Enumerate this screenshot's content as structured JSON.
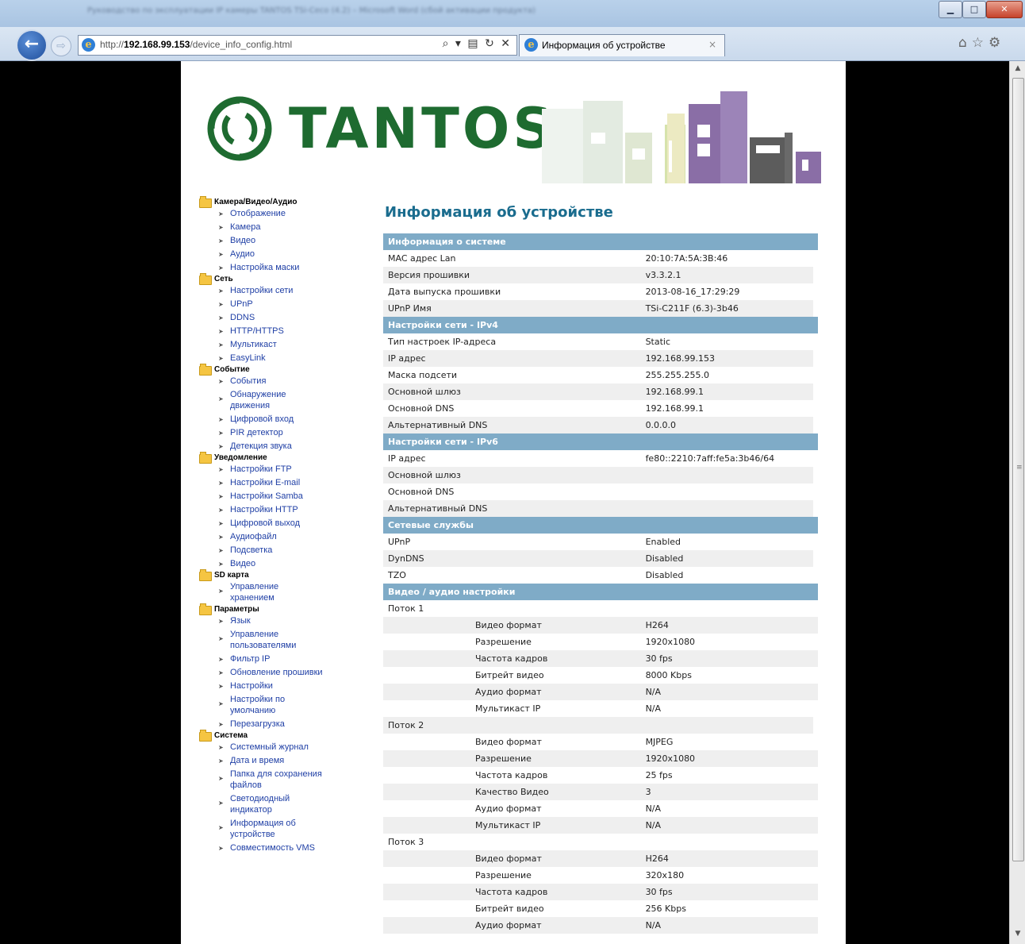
{
  "browser": {
    "url_prefix": "http://",
    "url_host": "192.168.99.153",
    "url_path": "/device_info_config.html",
    "address_icons": "⌕ ▾ ▤ ↻ ✕",
    "tab_title": "Информация об устройстве",
    "tab_close": "×",
    "title_blurred": "Руководство по эксплуатации IP камеры TANTOS TSi-Ceco (4.2) – Microsoft Word (сбой активации продукта)",
    "window_controls": {
      "minimize": "▁",
      "maximize": "□",
      "close": "✕"
    },
    "tools_icons": [
      "home-icon",
      "star-icon",
      "gear-icon"
    ]
  },
  "logo": {
    "text": "TANTOS",
    "brand_color": "#1e6b30"
  },
  "sidebar": [
    {
      "label": "Камера/Видео/Аудио",
      "items": [
        "Отображение",
        "Камера",
        "Видео",
        "Аудио",
        "Настройка маски"
      ]
    },
    {
      "label": "Сеть",
      "items": [
        "Настройки сети",
        "UPnP",
        "DDNS",
        "HTTP/HTTPS",
        "Мультикаст",
        "EasyLink"
      ]
    },
    {
      "label": "Событие",
      "items": [
        "События",
        "Обнаружение\nдвижения",
        "Цифровой вход",
        "PIR детектор",
        "Детекция звука"
      ]
    },
    {
      "label": "Уведомление",
      "items": [
        "Настройки FTP",
        "Настройки E-mail",
        "Настройки Samba",
        "Настройки HTTP",
        "Цифровой выход",
        "Аудиофайл",
        "Подсветка",
        "Видео"
      ]
    },
    {
      "label": "SD карта",
      "items": [
        "Управление\nхранением"
      ]
    },
    {
      "label": "Параметры",
      "items": [
        "Язык",
        "Управление\nпользователями",
        "Фильтр IP",
        "Обновление прошивки",
        "Настройки",
        "Настройки по\nумолчанию",
        "Перезагрузка"
      ]
    },
    {
      "label": "Система",
      "items": [
        "Системный журнал",
        "Дата и время",
        "Папка для сохранения\nфайлов",
        "Светодиодный\nиндикатор",
        "Информация об\nустройстве",
        "Совместимость VMS"
      ]
    }
  ],
  "main": {
    "title": "Информация об устройстве",
    "rows": [
      {
        "t": "sec",
        "k": "Информация о системе"
      },
      {
        "t": "kv",
        "k": "MAC адрес Lan",
        "v": "20:10:7A:5A:3B:46"
      },
      {
        "t": "kv",
        "k": "Версия прошивки",
        "v": "v3.3.2.1"
      },
      {
        "t": "kv",
        "k": "Дата выпуска прошивки",
        "v": "2013-08-16_17:29:29"
      },
      {
        "t": "kv",
        "k": "UPnP Имя",
        "v": "TSi-C211F (6.3)-3b46"
      },
      {
        "t": "sec",
        "k": "Настройки сети - IPv4"
      },
      {
        "t": "kv",
        "k": "Тип настроек IP-адреса",
        "v": "Static"
      },
      {
        "t": "kv",
        "k": "IP адрес",
        "v": "192.168.99.153"
      },
      {
        "t": "kv",
        "k": "Маска подсети",
        "v": "255.255.255.0"
      },
      {
        "t": "kv",
        "k": "Основной шлюз",
        "v": "192.168.99.1"
      },
      {
        "t": "kv",
        "k": "Основной DNS",
        "v": "192.168.99.1"
      },
      {
        "t": "kv",
        "k": "Альтернативный DNS",
        "v": "0.0.0.0"
      },
      {
        "t": "sec",
        "k": "Настройки сети - IPv6"
      },
      {
        "t": "kv",
        "k": "IP адрес",
        "v": "fe80::2210:7aff:fe5a:3b46/64"
      },
      {
        "t": "kv",
        "k": "Основной шлюз",
        "v": ""
      },
      {
        "t": "kv",
        "k": "Основной DNS",
        "v": ""
      },
      {
        "t": "kv",
        "k": "Альтернативный DNS",
        "v": ""
      },
      {
        "t": "sec",
        "k": "Сетевые службы"
      },
      {
        "t": "kv",
        "k": "UPnP",
        "v": "Enabled"
      },
      {
        "t": "kv",
        "k": "DynDNS",
        "v": "Disabled"
      },
      {
        "t": "kv",
        "k": "TZO",
        "v": "Disabled"
      },
      {
        "t": "sec",
        "k": "Видео / аудио настройки"
      },
      {
        "t": "kv",
        "k": "Поток 1",
        "v": ""
      },
      {
        "t": "sub",
        "k": "Видео формат",
        "v": "H264"
      },
      {
        "t": "sub",
        "k": "Разрешение",
        "v": "1920x1080"
      },
      {
        "t": "sub",
        "k": "Частота кадров",
        "v": "30 fps"
      },
      {
        "t": "sub",
        "k": "Битрейт видео",
        "v": "8000 Kbps"
      },
      {
        "t": "sub",
        "k": "Аудио формат",
        "v": "N/A"
      },
      {
        "t": "sub",
        "k": "Мультикаст IP",
        "v": "N/A"
      },
      {
        "t": "kv",
        "k": "Поток 2",
        "v": ""
      },
      {
        "t": "sub",
        "k": "Видео формат",
        "v": "MJPEG"
      },
      {
        "t": "sub",
        "k": "Разрешение",
        "v": "1920x1080"
      },
      {
        "t": "sub",
        "k": "Частота кадров",
        "v": "25 fps"
      },
      {
        "t": "sub",
        "k": "Качество Видео",
        "v": "3"
      },
      {
        "t": "sub",
        "k": "Аудио формат",
        "v": "N/A"
      },
      {
        "t": "sub",
        "k": "Мультикаст IP",
        "v": "N/A"
      },
      {
        "t": "kv",
        "k": "Поток 3",
        "v": ""
      },
      {
        "t": "sub",
        "k": "Видео формат",
        "v": "H264"
      },
      {
        "t": "sub",
        "k": "Разрешение",
        "v": "320x180"
      },
      {
        "t": "sub",
        "k": "Частота кадров",
        "v": "30 fps"
      },
      {
        "t": "sub",
        "k": "Битрейт видео",
        "v": "256 Kbps"
      },
      {
        "t": "sub",
        "k": "Аудио формат",
        "v": "N/A"
      }
    ]
  },
  "colors": {
    "section_header": "#7fabc7",
    "title": "#1a6c8e",
    "link": "#1f3fa5",
    "row_alt": "#efefef"
  }
}
